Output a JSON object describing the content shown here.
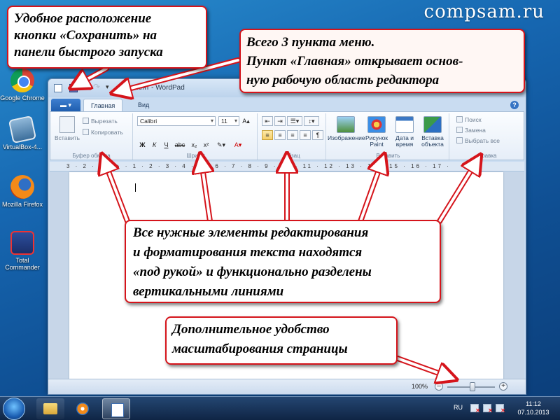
{
  "watermark": "compsam.ru",
  "desktop": {
    "icons": [
      {
        "label": "Google Chrome"
      },
      {
        "label": "VirtualBox-4..."
      },
      {
        "label": "Mozilla Firefox"
      },
      {
        "label": "Total Commander"
      }
    ]
  },
  "window": {
    "title": "Документ - WordPad",
    "controls": {
      "minimize": "–",
      "maximize": "□",
      "close": "✕"
    },
    "file_tab": "▬ ▾",
    "tabs": [
      {
        "label": "Главная",
        "active": true
      },
      {
        "label": "Вид",
        "active": false
      }
    ],
    "help": "?"
  },
  "ribbon": {
    "clipboard": {
      "label": "Буфер обмена",
      "paste": "Вставить",
      "cut": "Вырезать",
      "copy": "Копировать"
    },
    "font": {
      "label": "Шрифт",
      "family": "Calibri",
      "size": "11",
      "grow": "A▴",
      "shrink": "A▾",
      "bold": "Ж",
      "italic": "К",
      "underline": "Ч",
      "strike": "abc",
      "sub": "x₂",
      "sup": "x²",
      "highlight": "✎▾",
      "color": "A▾"
    },
    "paragraph": {
      "label": "Абзац",
      "align_left": "≡",
      "align_center": "≡",
      "align_right": "≡",
      "justify": "≡",
      "list": "☰▾",
      "indent_more": "⇥",
      "indent_less": "⇤",
      "spacing": "↕▾",
      "para_dialog": "¶"
    },
    "insert": {
      "label": "Вставить",
      "image": "Изображение",
      "paint": "Рисунок Paint",
      "datetime": "Дата и время",
      "object": "Вставка объекта"
    },
    "edit": {
      "label": "Правка",
      "find": "Поиск",
      "replace": "Замена",
      "select_all": "Выбрать все"
    }
  },
  "ruler": "3 · 2 · 1 · ⌂ · 1 · 2 · 3 · 4 · 5 · 6 · 7 · 8 · 9 · 10 · 11 · 12 · 13 · 14 · 15 · 16 · 17 ·",
  "statusbar": {
    "zoom": "100%",
    "zoom_minus": "–",
    "zoom_plus": "+",
    "zoom_level": 0.5
  },
  "taskbar": {
    "lang": "RU",
    "time": "11:12",
    "date": "07.10.2013"
  },
  "callouts": {
    "save": [
      "Удобное расположение",
      "кнопки «Сохранить» на",
      "панели быстрого запуска"
    ],
    "menu": [
      "Всего 3 пункта меню.",
      "Пункт «Главная» открывает основ-",
      "ную рабочую область редактора"
    ],
    "ribbon": [
      "Все нужные элементы редактирования",
      "и форматирования текста находятся",
      "«под рукой» и функционально разделены",
      "вертикальными линиями"
    ],
    "zoom": [
      "Дополнительное удобство",
      "масштабирования страницы"
    ]
  },
  "colors": {
    "callout_border": "#d5141b",
    "arrow_stroke": "#d5141b",
    "desktop": "#1666b0"
  }
}
